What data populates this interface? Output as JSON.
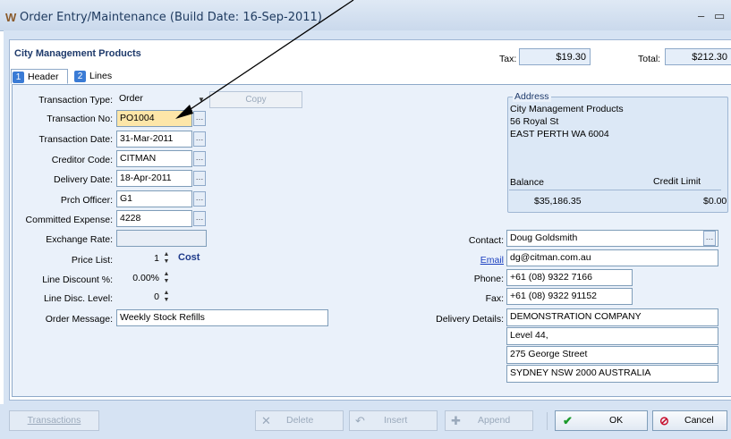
{
  "window": {
    "title": "Order Entry/Maintenance (Build Date: 16-Sep-2011)",
    "minimize": "–",
    "maximize": "▭"
  },
  "company": "City Management Products",
  "totals": {
    "tax_label": "Tax:",
    "tax_value": "$19.30",
    "total_label": "Total:",
    "total_value": "$212.30"
  },
  "tabs": [
    {
      "num": "1",
      "label": "Header"
    },
    {
      "num": "2",
      "label": "Lines"
    }
  ],
  "header": {
    "transaction_type": {
      "label": "Transaction Type:",
      "value": "Order"
    },
    "copy_button": "Copy",
    "transaction_no": {
      "label": "Transaction No:",
      "value": "PO1004"
    },
    "transaction_date": {
      "label": "Transaction Date:",
      "value": "31-Mar-2011"
    },
    "creditor_code": {
      "label": "Creditor Code:",
      "value": "CITMAN"
    },
    "delivery_date": {
      "label": "Delivery Date:",
      "value": "18-Apr-2011"
    },
    "prch_officer": {
      "label": "Prch Officer:",
      "value": "G1"
    },
    "committed_expense": {
      "label": "Committed Expense:",
      "value": "4228"
    },
    "exchange_rate": {
      "label": "Exchange Rate:",
      "value": ""
    },
    "price_list": {
      "label": "Price List:",
      "value": "1",
      "suffix": "Cost"
    },
    "line_discount": {
      "label": "Line Discount %:",
      "value": "0.00%"
    },
    "line_disc_level": {
      "label": "Line Disc. Level:",
      "value": "0"
    },
    "order_message": {
      "label": "Order Message:",
      "value": "Weekly Stock Refills"
    }
  },
  "address": {
    "legend": "Address",
    "lines": [
      "City Management Products",
      "56 Royal St",
      "EAST PERTH WA 6004"
    ],
    "balance_label": "Balance",
    "credit_limit_label": "Credit Limit",
    "balance_value": "$35,186.35",
    "credit_limit_value": "$0.00"
  },
  "contact": {
    "contact_label": "Contact:",
    "contact_value": "Doug Goldsmith",
    "email_label": "Email",
    "email_value": "dg@citman.com.au",
    "phone_label": "Phone:",
    "phone_value": "+61 (08) 9322 7166",
    "fax_label": "Fax:",
    "fax_value": "+61 (08) 9322 91152",
    "delivery_label": "Delivery Details:",
    "delivery_lines": [
      "DEMONSTRATION COMPANY",
      "Level 44,",
      "275 George Street",
      "SYDNEY NSW 2000 AUSTRALIA"
    ]
  },
  "bottom": {
    "transactions": "Transactions",
    "delete": "Delete",
    "insert": "Insert",
    "append": "Append",
    "ok": "OK",
    "cancel": "Cancel"
  }
}
